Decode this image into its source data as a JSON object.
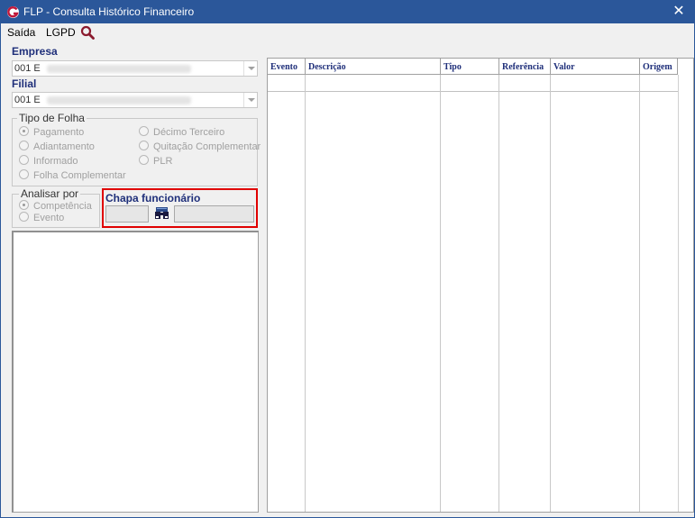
{
  "window": {
    "title": "FLP - Consulta Histórico Financeiro",
    "close_glyph": "✕",
    "accent_color": "#2b579a"
  },
  "menu": {
    "items": [
      "Saída",
      "LGPD"
    ],
    "search_icon": "search-icon"
  },
  "empresa": {
    "label": "Empresa",
    "value": "001 E"
  },
  "filial": {
    "label": "Filial",
    "value": "001 E"
  },
  "tipo_folha": {
    "title": "Tipo de Folha",
    "options": [
      {
        "label": "Pagamento",
        "selected": true
      },
      {
        "label": "Adiantamento",
        "selected": false
      },
      {
        "label": "Informado",
        "selected": false
      },
      {
        "label": "Folha Complementar",
        "selected": false
      },
      {
        "label": "Décimo Terceiro",
        "selected": false
      },
      {
        "label": "Quitação Complementar",
        "selected": false
      },
      {
        "label": "PLR",
        "selected": false
      }
    ]
  },
  "analisar_por": {
    "title": "Analisar por",
    "options": [
      {
        "label": "Competência",
        "selected": true
      },
      {
        "label": "Evento",
        "selected": false
      }
    ]
  },
  "chapa": {
    "label": "Chapa funcionário",
    "value": "",
    "name_value": "",
    "highlight_color": "#e00000"
  },
  "grid": {
    "columns": [
      "Evento",
      "Descrição",
      "Tipo",
      "Referência",
      "Valor",
      "Origem"
    ],
    "rows": []
  }
}
